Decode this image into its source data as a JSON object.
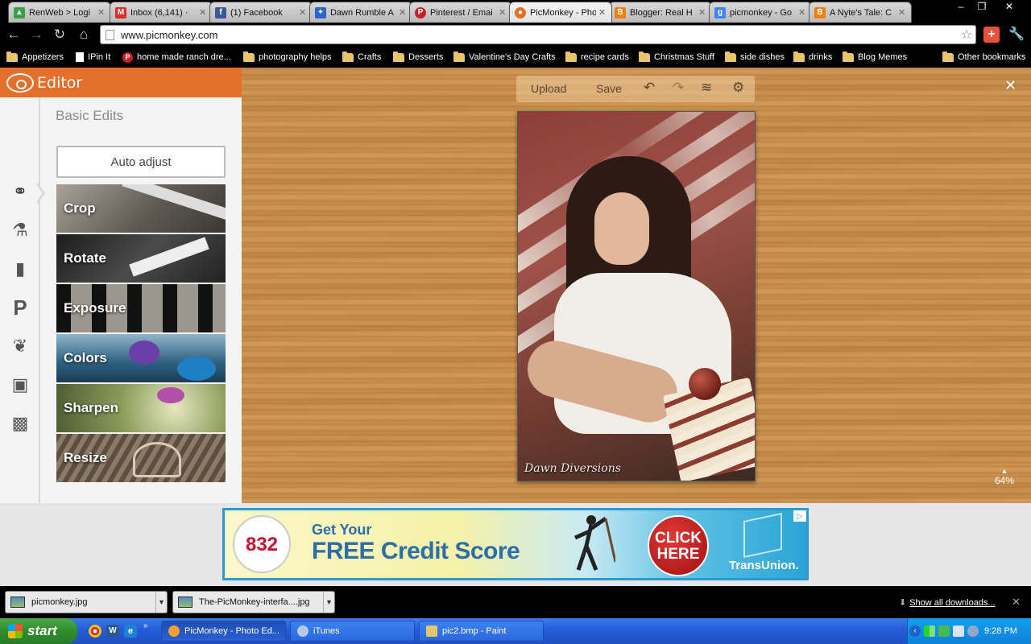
{
  "browser": {
    "tabs": [
      {
        "title": "RenWeb > Logi",
        "icon": "renweb-icon",
        "color": "#3aa046",
        "active": false
      },
      {
        "title": "Inbox (6,141) ·",
        "icon": "gmail-icon",
        "color": "#d93025",
        "active": false
      },
      {
        "title": "(1) Facebook",
        "icon": "facebook-icon",
        "color": "#3b5998",
        "active": false
      },
      {
        "title": "Dawn Rumble A",
        "icon": "runner-icon",
        "color": "#2b65c6",
        "active": false
      },
      {
        "title": "Pinterest / Emai",
        "icon": "pinterest-icon",
        "color": "#cb2027",
        "active": false
      },
      {
        "title": "PicMonkey - Pho",
        "icon": "picmonkey-icon",
        "color": "#e36f2b",
        "active": true
      },
      {
        "title": "Blogger: Real H",
        "icon": "blogger-icon",
        "color": "#f57d00",
        "active": false
      },
      {
        "title": "picmonkey - Go",
        "icon": "google-icon",
        "color": "#4285f4",
        "active": false
      },
      {
        "title": "A Nyte's Tale: C",
        "icon": "blogger-icon",
        "color": "#f57d00",
        "active": false
      }
    ],
    "url": "www.picmonkey.com",
    "bookmarks": [
      {
        "label": "Appetizers",
        "type": "folder"
      },
      {
        "label": "IPin It",
        "type": "page"
      },
      {
        "label": "home made ranch dre...",
        "type": "pinterest"
      },
      {
        "label": "photography helps",
        "type": "folder"
      },
      {
        "label": "Crafts",
        "type": "folder"
      },
      {
        "label": "Desserts",
        "type": "folder"
      },
      {
        "label": "Valentine's Day Crafts",
        "type": "folder"
      },
      {
        "label": "recipe cards",
        "type": "folder"
      },
      {
        "label": "Christmas Stuff",
        "type": "folder"
      },
      {
        "label": "side dishes",
        "type": "folder"
      },
      {
        "label": "drinks",
        "type": "folder"
      },
      {
        "label": "Blog Memes",
        "type": "folder"
      }
    ],
    "other_bookmarks": "Other bookmarks"
  },
  "editor": {
    "title": "Editor",
    "section_title": "Basic Edits",
    "auto_adjust": "Auto adjust",
    "tools": [
      {
        "label": "Crop",
        "bg": "#6f6a63"
      },
      {
        "label": "Rotate",
        "bg": "#3d3d3d"
      },
      {
        "label": "Exposure",
        "bg": "#2e2a26"
      },
      {
        "label": "Colors",
        "bg": "#3a6f8f"
      },
      {
        "label": "Sharpen",
        "bg": "#7b8c52"
      },
      {
        "label": "Resize",
        "bg": "#6a5a4c"
      }
    ],
    "rail_icons": [
      "basic-edits-icon",
      "effects-flask-icon",
      "touch-up-lipstick-icon",
      "text-p-icon",
      "overlays-butterfly-icon",
      "frames-icon",
      "textures-icon"
    ],
    "photo_toolbar": {
      "upload": "Upload",
      "save": "Save"
    },
    "zoom": "64%",
    "watermark": "Dawn Diversions"
  },
  "ad": {
    "number": "832",
    "line1": "Get Your",
    "line2": "FREE Credit Score",
    "cta": "CLICK HERE",
    "brand": "TransUnion."
  },
  "downloads": {
    "items": [
      "picmonkey.jpg",
      "The-PicMonkey-interfa....jpg"
    ],
    "show_all": "Show all downloads..."
  },
  "taskbar": {
    "start": "start",
    "tasks": [
      {
        "label": "PicMonkey - Photo Ed...",
        "active": true,
        "color": "#f0a030"
      },
      {
        "label": "iTunes",
        "active": false,
        "color": "#b7c8e8"
      },
      {
        "label": "pic2.bmp - Paint",
        "active": false,
        "color": "#e7c66a"
      }
    ],
    "clock": "9:28 PM"
  }
}
